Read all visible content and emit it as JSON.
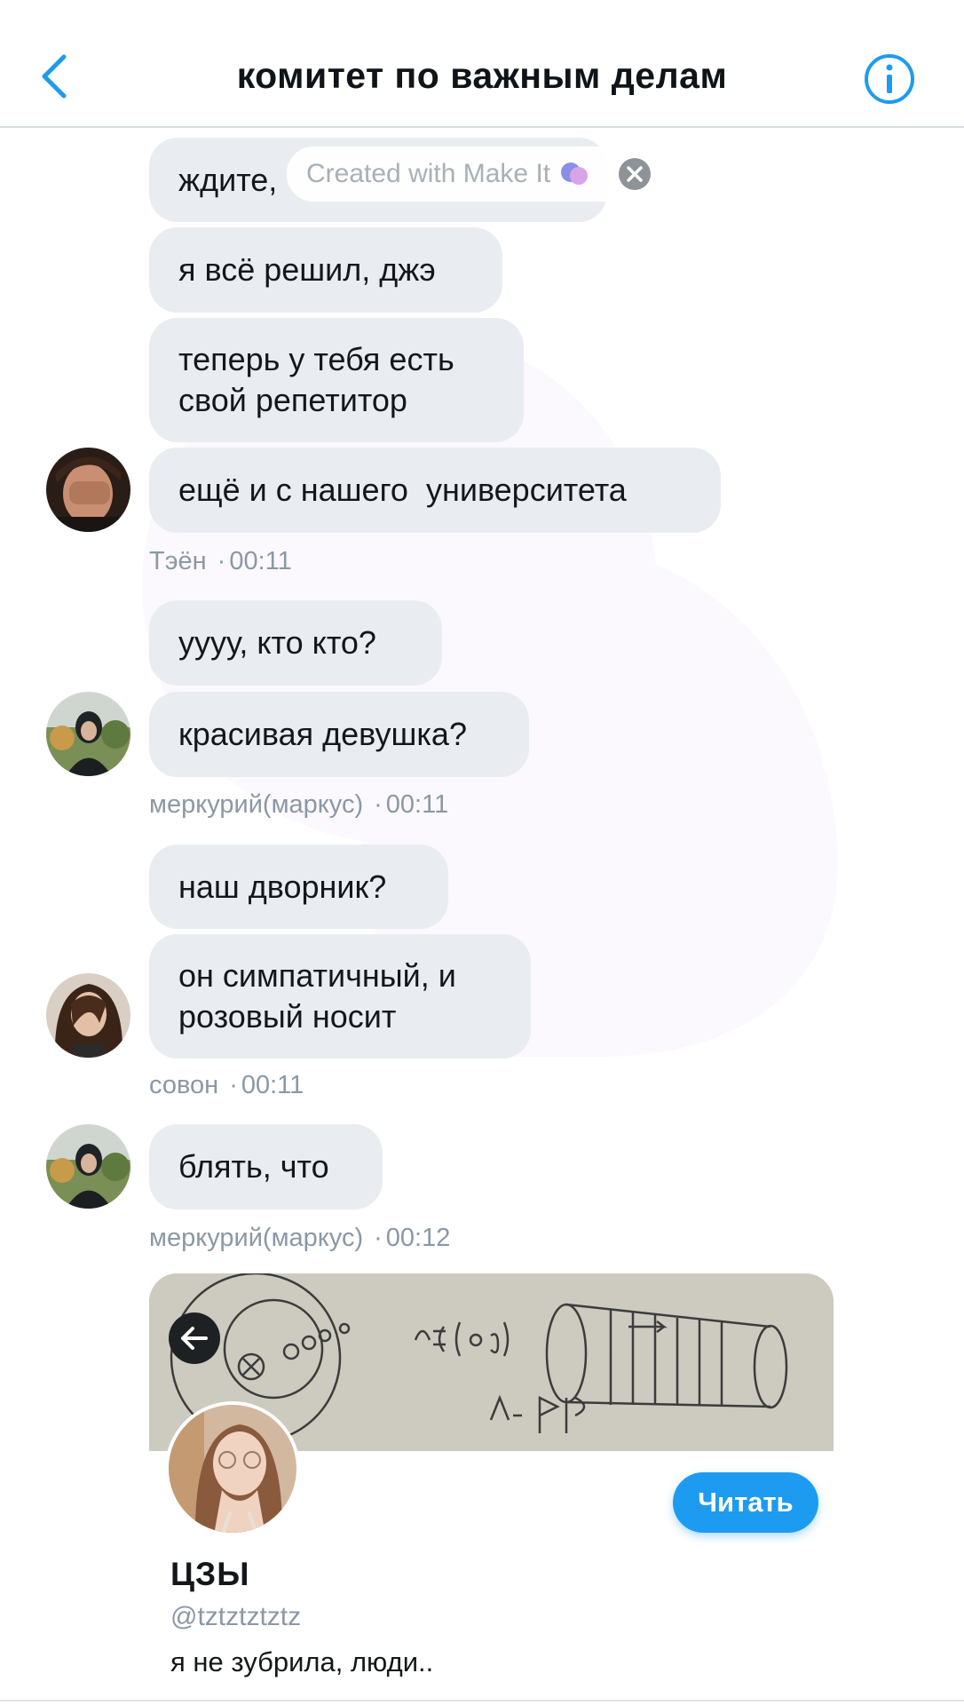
{
  "header": {
    "title": "комитет по важным делам",
    "back_icon": "chevron-left-icon",
    "info_icon": "info-circle-icon",
    "accent_color": "#1d9bf0"
  },
  "watermark": {
    "text": "Created with Make It"
  },
  "messages": [
    {
      "text": "ждите,"
    },
    {
      "text": "я всё решил, джэ"
    },
    {
      "text": "теперь у тебя есть свой репетитор"
    },
    {
      "text": "ещё и с нашего  университета"
    },
    {
      "text": "уууу, кто кто?"
    },
    {
      "text": "красивая девушка?"
    },
    {
      "text": "наш дворник?"
    },
    {
      "text": "он симпатичный, и розовый носит"
    },
    {
      "text": "блять, что"
    }
  ],
  "meta": [
    {
      "sender": "Тэён",
      "time": "00:11"
    },
    {
      "sender": "меркурий(маркус)",
      "time": "00:11"
    },
    {
      "sender": "совон",
      "time": "00:11"
    },
    {
      "sender": "меркурий(маркус)",
      "time": "00:12"
    }
  ],
  "card": {
    "name": "ЦЗЫ",
    "handle": "@tztztztztz",
    "bio": "я не зубрила, люди..",
    "follow_label": "Читать"
  }
}
